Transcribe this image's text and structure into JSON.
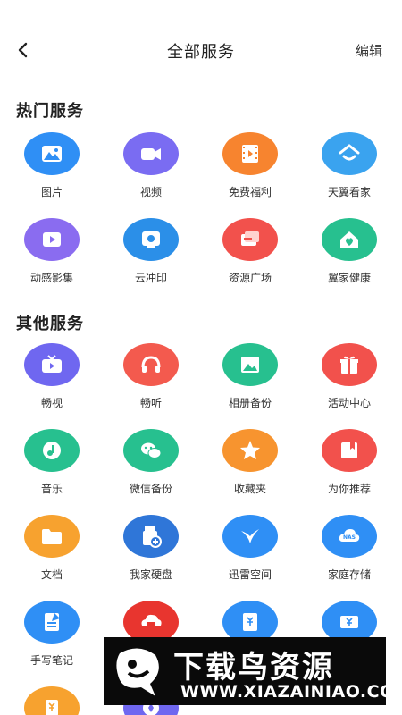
{
  "header": {
    "title": "全部服务",
    "edit_label": "编辑"
  },
  "sections": {
    "hot": {
      "title": "热门服务",
      "items": [
        {
          "label": "图片",
          "icon": "image-icon",
          "color": "#2f8ff5"
        },
        {
          "label": "视频",
          "icon": "video-icon",
          "color": "#7a6cf2"
        },
        {
          "label": "免费福利",
          "icon": "film-icon",
          "color": "#f7842f"
        },
        {
          "label": "天翼看家",
          "icon": "home-camera-icon",
          "color": "#3aa3ef"
        },
        {
          "label": "动感影集",
          "icon": "album-video-icon",
          "color": "#8a6cf0"
        },
        {
          "label": "云冲印",
          "icon": "print-icon",
          "color": "#2b8fe8"
        },
        {
          "label": "资源广场",
          "icon": "resource-icon",
          "color": "#f2514c"
        },
        {
          "label": "翼家健康",
          "icon": "health-home-icon",
          "color": "#27c08f"
        }
      ]
    },
    "other": {
      "title": "其他服务",
      "items": [
        {
          "label": "畅视",
          "icon": "tv-icon",
          "color": "#6f67f0"
        },
        {
          "label": "畅听",
          "icon": "headphones-icon",
          "color": "#f35a4e"
        },
        {
          "label": "相册备份",
          "icon": "photo-backup-icon",
          "color": "#27c08f"
        },
        {
          "label": "活动中心",
          "icon": "gift-icon",
          "color": "#f2514c"
        },
        {
          "label": "音乐",
          "icon": "music-icon",
          "color": "#27c08f"
        },
        {
          "label": "微信备份",
          "icon": "wechat-icon",
          "color": "#27c08f"
        },
        {
          "label": "收藏夹",
          "icon": "star-icon",
          "color": "#f7942f"
        },
        {
          "label": "为你推荐",
          "icon": "recommend-icon",
          "color": "#f2514c"
        },
        {
          "label": "文档",
          "icon": "folder-icon",
          "color": "#f7a22f"
        },
        {
          "label": "我家硬盘",
          "icon": "usb-drive-icon",
          "color": "#2f76d8"
        },
        {
          "label": "迅雷空间",
          "icon": "thunder-bird-icon",
          "color": "#2f8ff5"
        },
        {
          "label": "家庭存储",
          "icon": "nas-icon",
          "color": "#2f8ff5"
        },
        {
          "label": "手写笔记",
          "icon": "note-icon",
          "color": "#2f8ff5"
        },
        {
          "label": "",
          "icon": "cloud-printer-icon",
          "color": "#e8352f"
        },
        {
          "label": "",
          "icon": "bill-icon",
          "color": "#2f8ff5"
        },
        {
          "label": "",
          "icon": "ticket-icon",
          "color": "#2f8ff5"
        },
        {
          "label": "",
          "icon": "coin-icon",
          "color": "#f7a22f"
        },
        {
          "label": "",
          "icon": "service-icon",
          "color": "#6f67f0"
        }
      ]
    }
  },
  "banner": {
    "title": "下载鸟资源",
    "url": "WWW.XIAZAINIAO.COM"
  },
  "colors": {
    "banner_bg": "#0a0a0a",
    "title_text": "#222222"
  }
}
